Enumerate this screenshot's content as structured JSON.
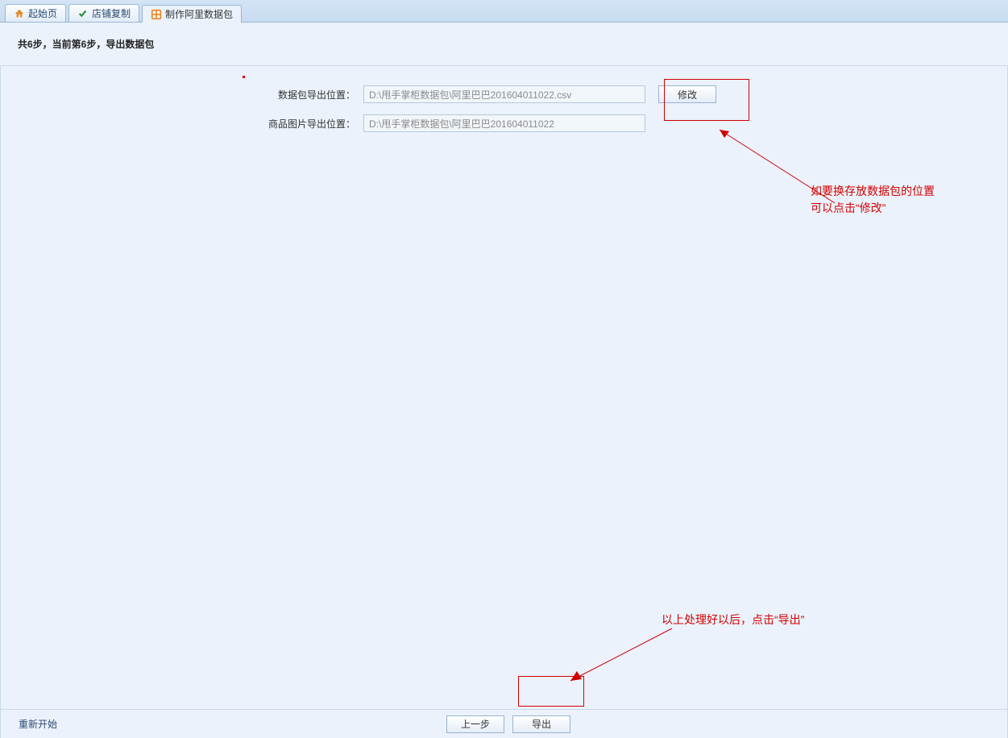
{
  "tabs": [
    {
      "label": "起始页",
      "icon": "home-icon"
    },
    {
      "label": "店铺复制",
      "icon": "check-icon"
    },
    {
      "label": "制作阿里数据包",
      "icon": "grid-icon"
    }
  ],
  "active_tab_index": 2,
  "step_line": "共6步，当前第6步，导出数据包",
  "form": {
    "export_path_label": "数据包导出位置：",
    "export_path_value": "D:\\甩手掌柜数据包\\阿里巴巴201604011022.csv",
    "image_path_label": "商品图片导出位置：",
    "image_path_value": "D:\\甩手掌柜数据包\\阿里巴巴201604011022",
    "modify_button": "修改"
  },
  "annotations": {
    "modify_hint_line1": "如要换存放数据包的位置",
    "modify_hint_line2": "可以点击“修改”",
    "export_hint": "以上处理好以后，点击“导出”"
  },
  "footer": {
    "restart": "重新开始",
    "prev": "上一步",
    "export": "导出"
  }
}
